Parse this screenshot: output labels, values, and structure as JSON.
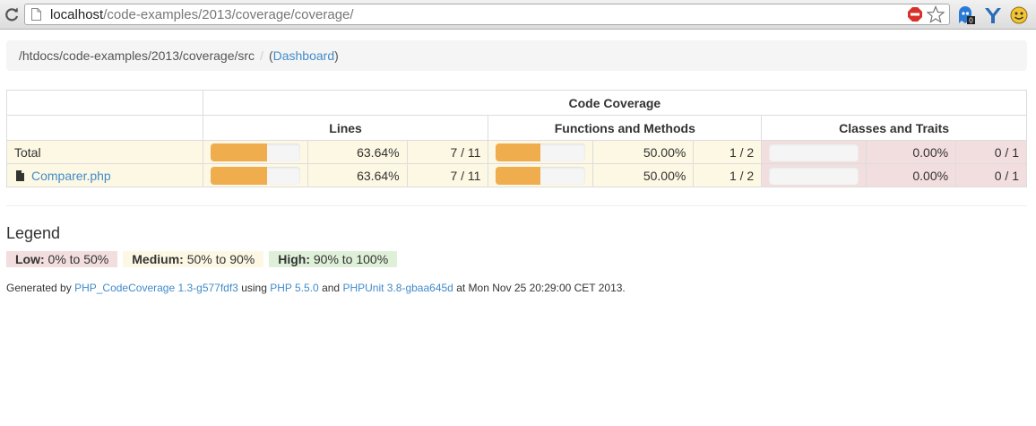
{
  "browser": {
    "url_host": "localhost",
    "url_path": "/code-examples/2013/coverage/coverage/",
    "extension_badge": "0"
  },
  "breadcrumb": {
    "path": "/htdocs/code-examples/2013/coverage/src",
    "separator": "/",
    "link_open": "(",
    "link_label": "Dashboard",
    "link_close": ")"
  },
  "table": {
    "group_header": "Code Coverage",
    "columns": [
      "Lines",
      "Functions and Methods",
      "Classes and Traits"
    ],
    "rows": [
      {
        "name": "Total",
        "lines": {
          "percent": 63.64,
          "percent_text": "63.64%",
          "ratio": "7 / 11"
        },
        "functions": {
          "percent": 50,
          "percent_text": "50.00%",
          "ratio": "1 / 2"
        },
        "classes": {
          "percent": 0,
          "percent_text": "0.00%",
          "ratio": "0 / 1"
        }
      },
      {
        "name": "Comparer.php",
        "lines": {
          "percent": 63.64,
          "percent_text": "63.64%",
          "ratio": "7 / 11"
        },
        "functions": {
          "percent": 50,
          "percent_text": "50.00%",
          "ratio": "1 / 2"
        },
        "classes": {
          "percent": 0,
          "percent_text": "0.00%",
          "ratio": "0 / 1"
        }
      }
    ]
  },
  "legend": {
    "title": "Legend",
    "low_label": "Low:",
    "low_range": "0% to 50%",
    "medium_label": "Medium:",
    "medium_range": "50% to 90%",
    "high_label": "High:",
    "high_range": "90% to 100%"
  },
  "footer": {
    "prefix": "Generated by",
    "tool_link": "PHP_CodeCoverage 1.3-g577fdf3",
    "using": "using",
    "php_link": "PHP 5.5.0",
    "and": "and",
    "phpunit_link": "PHPUnit 3.8-gbaa645d",
    "suffix": "at Mon Nov 25 20:29:00 CET 2013."
  },
  "colors": {
    "progress_fill": "#f0ad4e",
    "warning_bg": "#fcf8e3",
    "danger_bg": "#f2dede",
    "success_bg": "#dff0d8",
    "link": "#428bca"
  }
}
